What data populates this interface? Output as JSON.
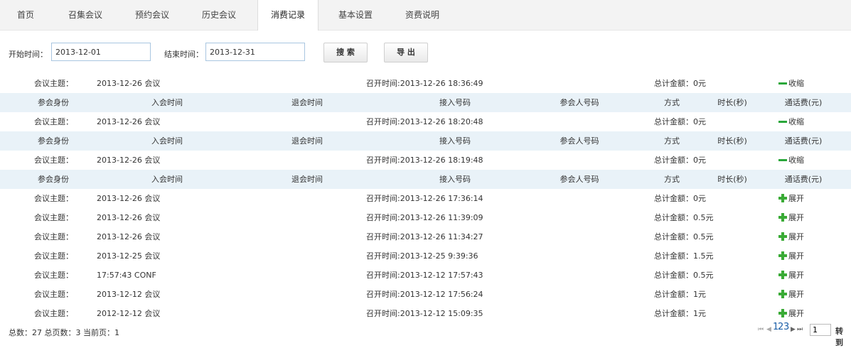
{
  "tabs": [
    {
      "label": "首页"
    },
    {
      "label": "召集会议"
    },
    {
      "label": "预约会议"
    },
    {
      "label": "历史会议"
    },
    {
      "label": "消费记录",
      "active": true
    },
    {
      "label": "基本设置"
    },
    {
      "label": "资费说明"
    }
  ],
  "filter": {
    "start_label": "开始时间：",
    "start_value": "2013-12-01",
    "end_label": "结束时间：",
    "end_value": "2013-12-31",
    "search_label": "搜 索",
    "export_label": "导 出"
  },
  "labels": {
    "subject": "会议主题：",
    "collapse": "收缩",
    "expand": "展开"
  },
  "detail_headers": [
    "参会身份",
    "入会时间",
    "退会时间",
    "接入号码",
    "参会人号码",
    "方式",
    "时长(秒)",
    "通话费(元)"
  ],
  "meetings": [
    {
      "subject": "2013-12-26 会议",
      "start": "召开时间:2013-12-26 18:36:49",
      "total": "总计金额：0元",
      "expanded": true
    },
    {
      "subject": "2013-12-26 会议",
      "start": "召开时间:2013-12-26 18:20:48",
      "total": "总计金额：0元",
      "expanded": true
    },
    {
      "subject": "2013-12-26 会议",
      "start": "召开时间:2013-12-26 18:19:48",
      "total": "总计金额：0元",
      "expanded": true
    },
    {
      "subject": "2013-12-26 会议",
      "start": "召开时间:2013-12-26 17:36:14",
      "total": "总计金额：0元",
      "expanded": false
    },
    {
      "subject": "2013-12-26 会议",
      "start": "召开时间:2013-12-26 11:39:09",
      "total": "总计金额：0.5元",
      "expanded": false
    },
    {
      "subject": "2013-12-26 会议",
      "start": "召开时间:2013-12-26 11:34:27",
      "total": "总计金额：0.5元",
      "expanded": false
    },
    {
      "subject": "2013-12-25 会议",
      "start": "召开时间:2013-12-25 9:39:36",
      "total": "总计金额：1.5元",
      "expanded": false
    },
    {
      "subject": "17:57:43 CONF",
      "start": "召开时间:2013-12-12 17:57:43",
      "total": "总计金额：0.5元",
      "expanded": false
    },
    {
      "subject": "2013-12-12 会议",
      "start": "召开时间:2013-12-12 17:56:24",
      "total": "总计金额：1元",
      "expanded": false
    },
    {
      "subject": "2012-12-12 会议",
      "start": "召开时间:2013-12-12 15:09:35",
      "total": "总计金额：1元",
      "expanded": false
    }
  ],
  "footer": {
    "summary": "总数：27 总页数：3 当前页：1"
  },
  "pager": {
    "pages": [
      "1",
      "2",
      "3"
    ],
    "current": "1",
    "go_label": "转到"
  },
  "icons": {
    "collapse": "minus-icon",
    "expand": "plus-icon",
    "first": "first-page-icon",
    "prev": "prev-page-icon",
    "next": "next-page-icon",
    "last": "last-page-icon"
  },
  "colors": {
    "tab_bar": "#f3f3f3",
    "header_row": "#e9f2f8",
    "accent_green": "#3aab36",
    "input_border": "#a9c6e0"
  }
}
